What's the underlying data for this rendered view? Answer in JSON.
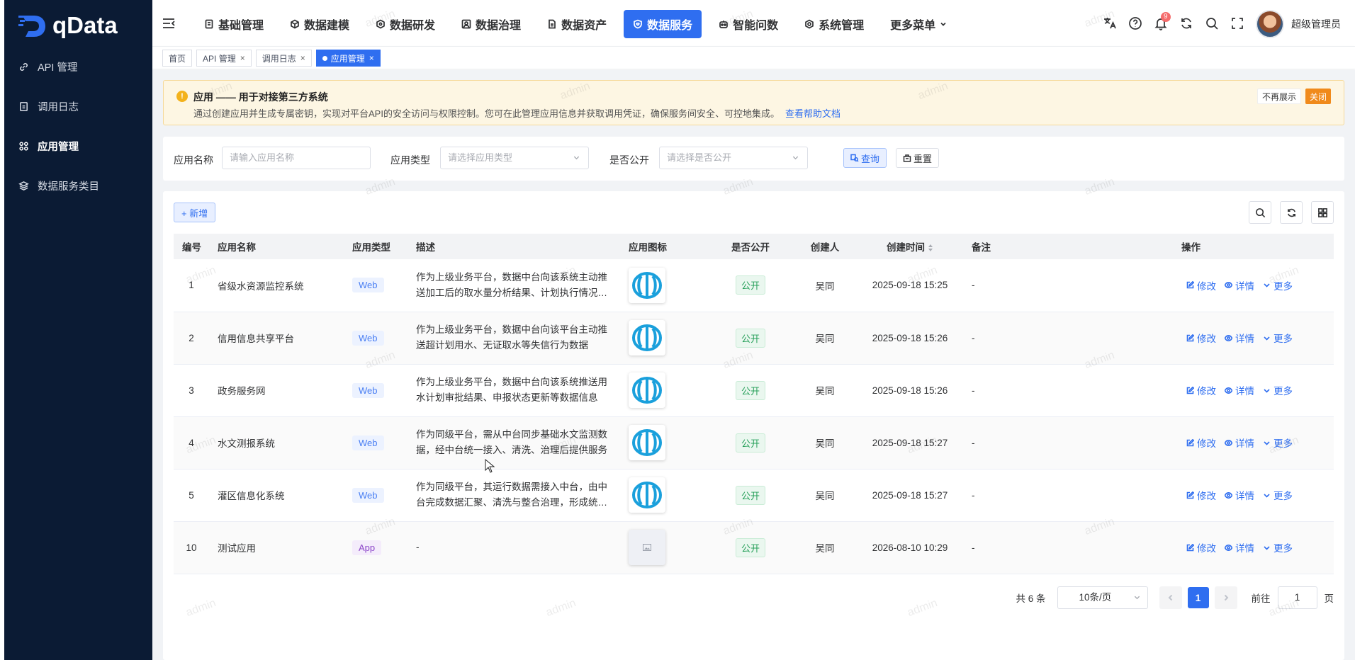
{
  "app": {
    "logo_text": "qData"
  },
  "sidebar": {
    "items": [
      {
        "label": "API 管理",
        "icon": "link-icon"
      },
      {
        "label": "调用日志",
        "icon": "log-icon"
      },
      {
        "label": "应用管理",
        "icon": "app-icon"
      },
      {
        "label": "数据服务类目",
        "icon": "layers-icon"
      }
    ]
  },
  "nav": {
    "items": [
      {
        "label": "基础管理"
      },
      {
        "label": "数据建模"
      },
      {
        "label": "数据研发"
      },
      {
        "label": "数据治理"
      },
      {
        "label": "数据资产"
      },
      {
        "label": "数据服务"
      },
      {
        "label": "智能问数"
      },
      {
        "label": "系统管理"
      },
      {
        "label": "更多菜单"
      }
    ],
    "notifications_badge": "9",
    "username": "超级管理员"
  },
  "tags": [
    {
      "label": "首页"
    },
    {
      "label": "API 管理"
    },
    {
      "label": "调用日志"
    },
    {
      "label": "应用管理"
    }
  ],
  "alert": {
    "icon": "!",
    "title": "应用 —— 用于对接第三方系统",
    "desc": "通过创建应用并生成专属密钥，实现对平台API的安全访问与权限控制。您可在此管理应用信息并获取调用凭证，确保服务间安全、可控地集成。",
    "link": "查看帮助文档",
    "dismiss_label": "不再展示",
    "close_label": "关闭"
  },
  "filter": {
    "name_label": "应用名称",
    "name_placeholder": "请输入应用名称",
    "type_label": "应用类型",
    "type_placeholder": "请选择应用类型",
    "public_label": "是否公开",
    "public_placeholder": "请选择是否公开",
    "query_label": "查询",
    "reset_label": "重置"
  },
  "toolbar": {
    "add_label": "+ 新增"
  },
  "table": {
    "headers": [
      "编号",
      "应用名称",
      "应用类型",
      "描述",
      "应用图标",
      "是否公开",
      "创建人",
      "创建时间",
      "备注",
      "操作"
    ],
    "rows": [
      {
        "id": "1",
        "name": "省级水资源监控系统",
        "type": "Web",
        "desc": "作为上级业务平台，数据中台向该系统主动推送加工后的取水量分析结果、计划执行情况等数据",
        "public": "公开",
        "creator": "吴同",
        "created": "2025-09-18 15:25",
        "remark": "-",
        "icon": "water-logo"
      },
      {
        "id": "2",
        "name": "信用信息共享平台",
        "type": "Web",
        "desc": "作为上级业务平台，数据中台向该平台主动推送超计划用水、无证取水等失信行为数据",
        "public": "公开",
        "creator": "吴同",
        "created": "2025-09-18 15:26",
        "remark": "-",
        "icon": "water-logo"
      },
      {
        "id": "3",
        "name": "政务服务网",
        "type": "Web",
        "desc": "作为上级业务平台，数据中台向该系统推送用水计划审批结果、申报状态更新等数据信息",
        "public": "公开",
        "creator": "吴同",
        "created": "2025-09-18 15:26",
        "remark": "-",
        "icon": "water-logo"
      },
      {
        "id": "4",
        "name": "水文测报系统",
        "type": "Web",
        "desc": "作为同级平台，需从中台同步基础水文监测数据，经中台统一接入、清洗、治理后提供服务",
        "public": "公开",
        "creator": "吴同",
        "created": "2025-09-18 15:27",
        "remark": "-",
        "icon": "water-logo"
      },
      {
        "id": "5",
        "name": "灌区信息化系统",
        "type": "Web",
        "desc": "作为同级平台，其运行数据需接入中台，由中台完成数据汇聚、清洗与整合治理，形成统一数据资产",
        "public": "公开",
        "creator": "吴同",
        "created": "2025-09-18 15:27",
        "remark": "-",
        "icon": "water-logo"
      },
      {
        "id": "10",
        "name": "测试应用",
        "type": "App",
        "desc": "-",
        "public": "公开",
        "creator": "吴同",
        "created": "2026-08-10 10:29",
        "remark": "-",
        "icon": "image-placeholder"
      }
    ],
    "ops": {
      "edit": "修改",
      "detail": "详情",
      "more": "更多"
    }
  },
  "pager": {
    "total": "共 6 条",
    "page_size": "10条/页",
    "current": "1",
    "goto_label": "前往",
    "goto_value": "1",
    "page_suffix": "页"
  },
  "watermark": "admin",
  "colors": {
    "primary": "#2f6ef0",
    "sidebar": "#0b1b34",
    "success": "#27a05a",
    "warning": "#f08a1b"
  }
}
